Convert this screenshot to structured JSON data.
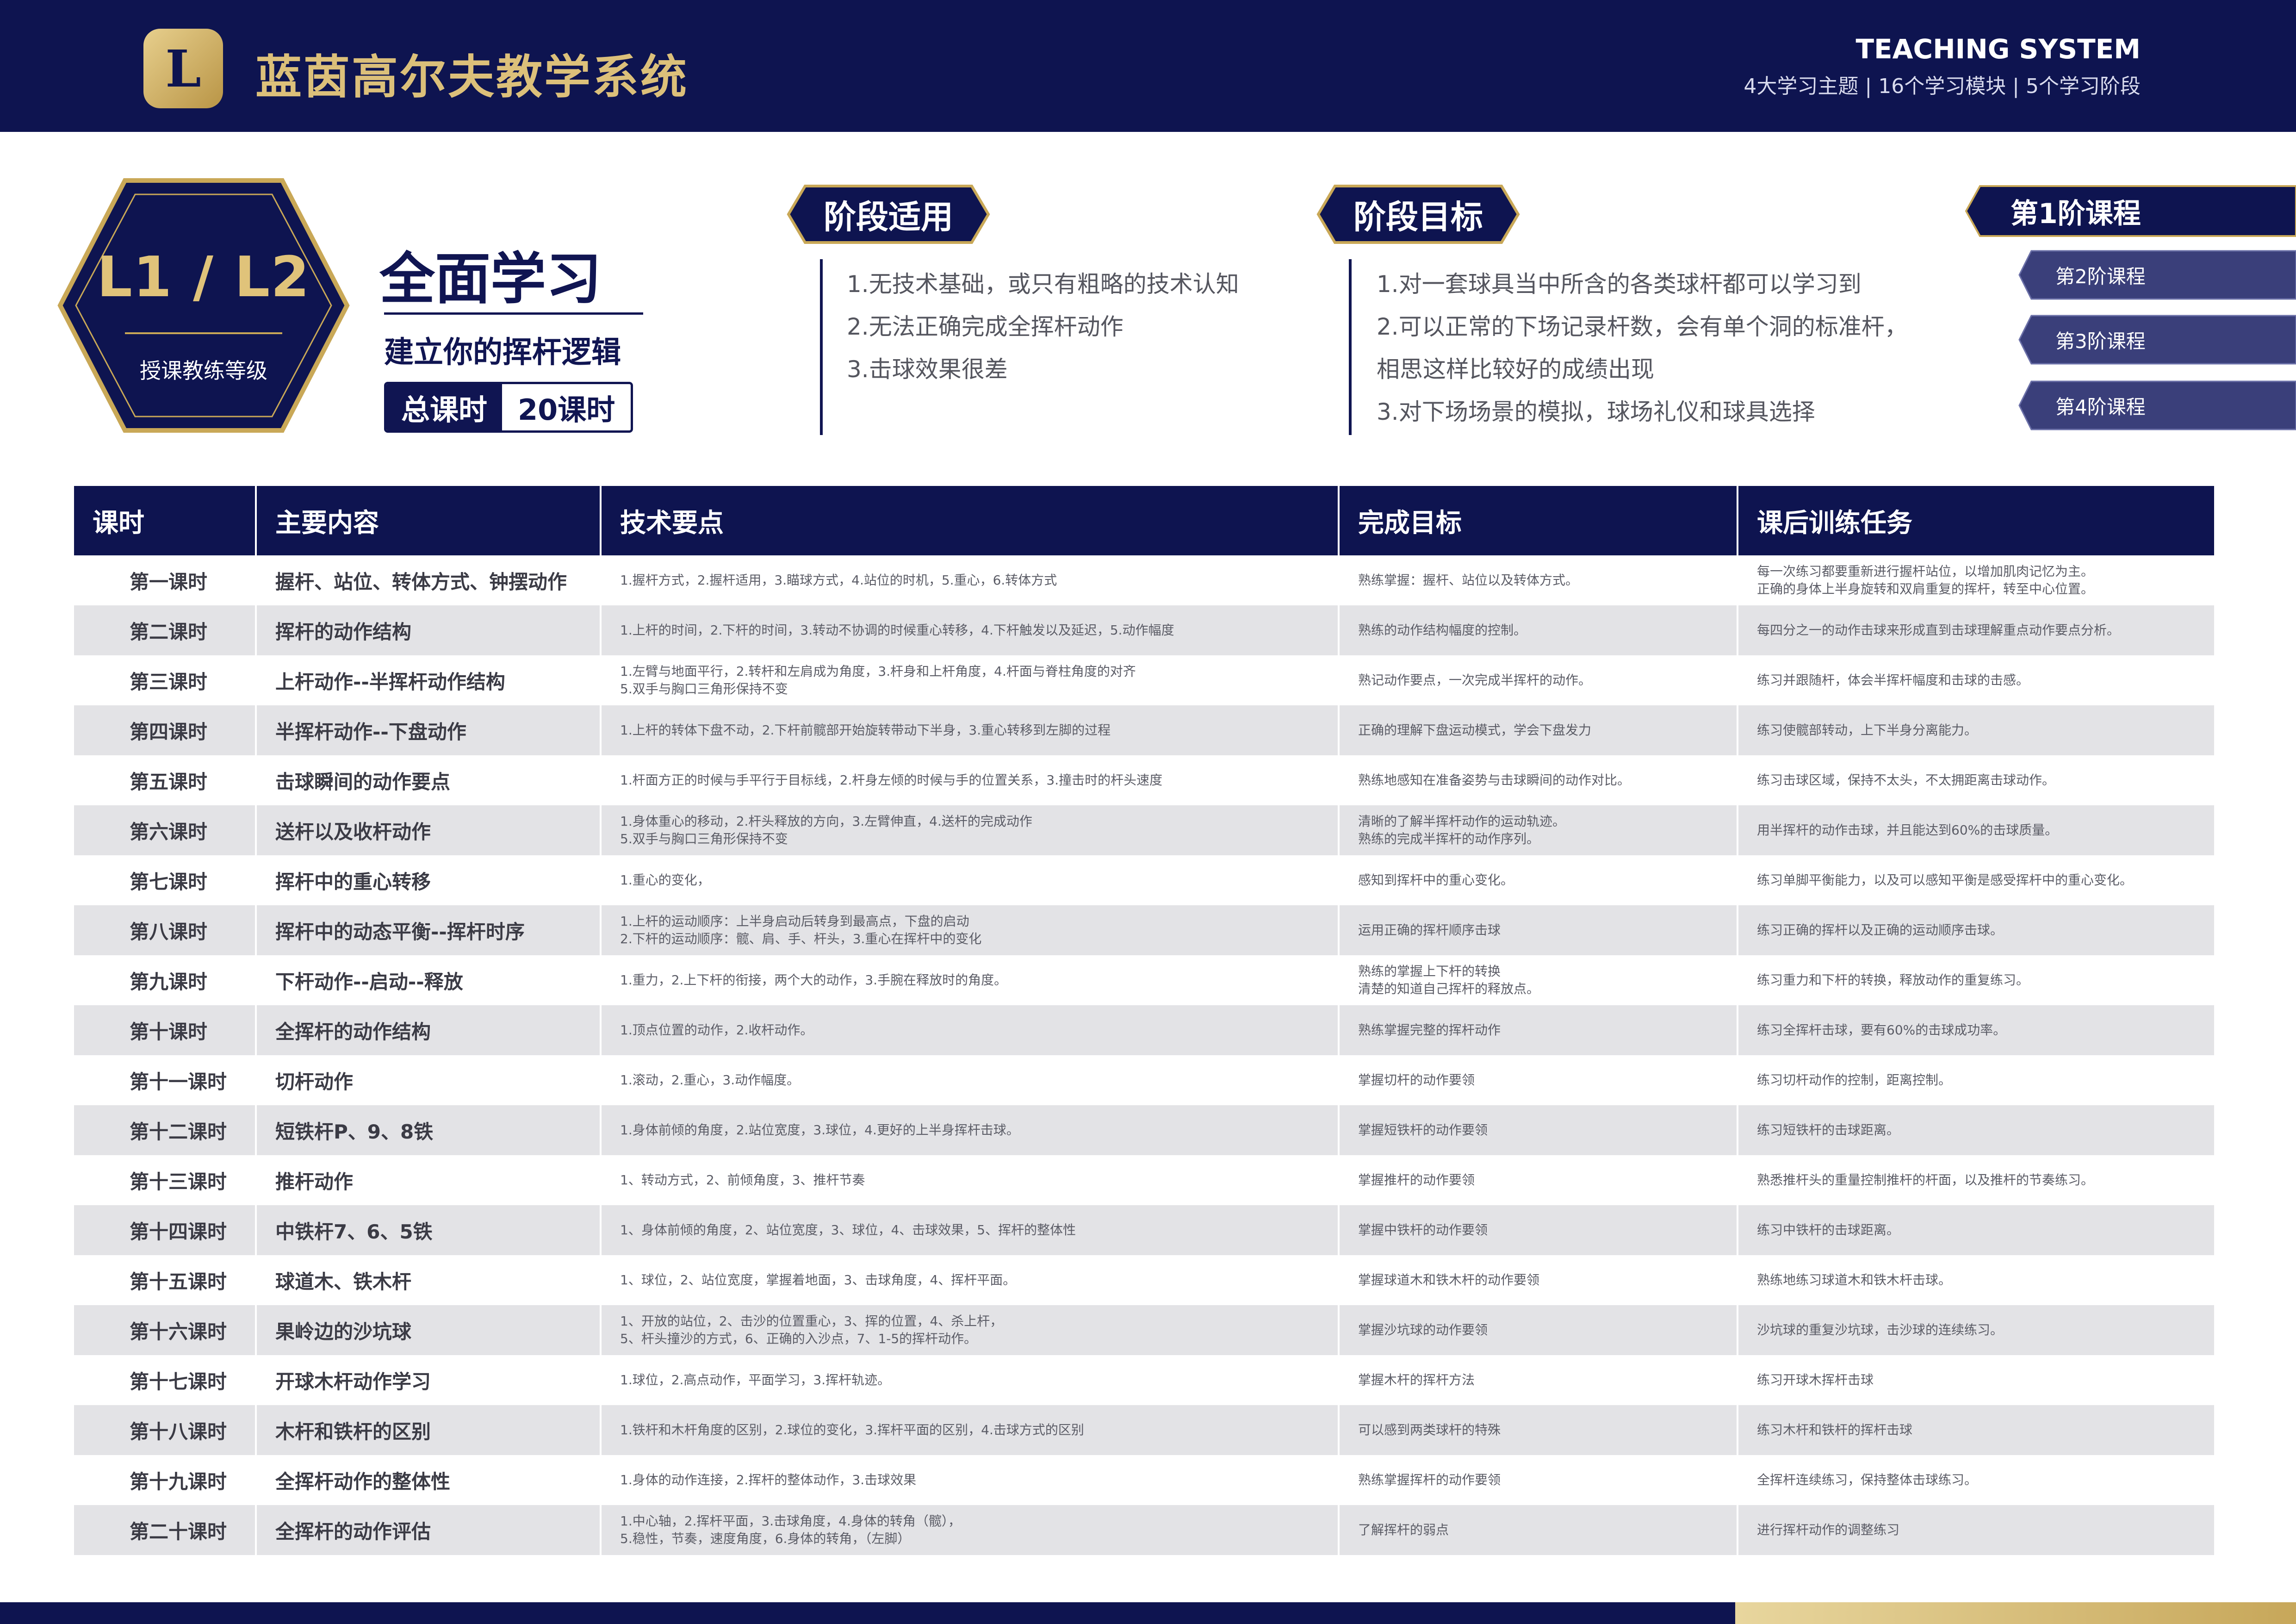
{
  "header": {
    "brand": "蓝茵高尔夫教学系统",
    "system_title": "TEACHING SYSTEM",
    "system_subtitle": "4大学习主题 | 16个学习模块 | 5个学习阶段",
    "logo_icon": "golf-logo-icon",
    "colors": {
      "navy": "#0e1450",
      "gold": "#dcc07a"
    }
  },
  "level": {
    "badge": "L1 / L2",
    "label": "授课教练等级",
    "title": "全面学习",
    "subtitle": "建立你的挥杆逻辑",
    "hours_label": "总课时",
    "hours_value": "20课时"
  },
  "applicable": {
    "heading": "阶段适用",
    "items": [
      "1.无技术基础，或只有粗略的技术认知",
      "2.无法正确完成全挥杆动作",
      "3.击球效果很差"
    ]
  },
  "goals": {
    "heading": "阶段目标",
    "items": [
      "1.对一套球具当中所含的各类球杆都可以学习到",
      "2.可以正常的下场记录杆数，会有单个洞的标准杆，",
      "   相思这样比较好的成绩出现",
      "3.对下场场景的模拟，球场礼仪和球具选择"
    ]
  },
  "stages": {
    "current": "第1阶课程",
    "others": [
      "第2阶课程",
      "第3阶课程",
      "第4阶课程"
    ]
  },
  "table": {
    "headers": [
      "课时",
      "主要内容",
      "技术要点",
      "完成目标",
      "课后训练任务"
    ],
    "rows": [
      [
        "第一课时",
        "握杆、站位、转体方式、钟摆动作",
        "1.握杆方式，2.握杆适用，3.瞄球方式，4.站位的时机，5.重心，6.转体方式",
        "熟练掌握：握杆、站位以及转体方式。",
        "每一次练习都要重新进行握杆站位，以增加肌肉记忆为主。\n正确的身体上半身旋转和双肩重复的挥杆，转至中心位置。"
      ],
      [
        "第二课时",
        "挥杆的动作结构",
        "1.上杆的时间，2.下杆的时间，3.转动不协调的时候重心转移，4.下杆触发以及延迟，5.动作幅度",
        "熟练的动作结构幅度的控制。",
        "每四分之一的动作击球来形成直到击球理解重点动作要点分析。"
      ],
      [
        "第三课时",
        "上杆动作--半挥杆动作结构",
        "1.左臂与地面平行，2.转杆和左肩成为角度，3.杆身和上杆角度，4.杆面与脊柱角度的对齐\n5.双手与胸口三角形保持不变",
        "熟记动作要点，一次完成半挥杆的动作。",
        "练习并跟随杆，体会半挥杆幅度和击球的击感。"
      ],
      [
        "第四课时",
        "半挥杆动作--下盘动作",
        "1.上杆的转体下盘不动，2.下杆前髋部开始旋转带动下半身，3.重心转移到左脚的过程",
        "正确的理解下盘运动模式，学会下盘发力",
        "练习使髋部转动，上下半身分离能力。"
      ],
      [
        "第五课时",
        "击球瞬间的动作要点",
        "1.杆面方正的时候与手平行于目标线，2.杆身左倾的时候与手的位置关系，3.撞击时的杆头速度",
        "熟练地感知在准备姿势与击球瞬间的动作对比。",
        "练习击球区域，保持不太头，不太拥距离击球动作。"
      ],
      [
        "第六课时",
        "送杆以及收杆动作",
        "1.身体重心的移动，2.杆头释放的方向，3.左臂伸直，4.送杆的完成动作\n5.双手与胸口三角形保持不变",
        "清晰的了解半挥杆动作的运动轨迹。\n熟练的完成半挥杆的动作序列。",
        "用半挥杆的动作击球，并且能达到60%的击球质量。"
      ],
      [
        "第七课时",
        "挥杆中的重心转移",
        "1.重心的变化，",
        "感知到挥杆中的重心变化。",
        "练习单脚平衡能力，以及可以感知平衡是感受挥杆中的重心变化。"
      ],
      [
        "第八课时",
        "挥杆中的动态平衡--挥杆时序",
        "1.上杆的运动顺序：上半身启动后转身到最高点，下盘的启动\n2.下杆的运动顺序：髋、肩、手、杆头，3.重心在挥杆中的变化",
        "运用正确的挥杆顺序击球",
        "练习正确的挥杆以及正确的运动顺序击球。"
      ],
      [
        "第九课时",
        "下杆动作--启动--释放",
        "1.重力，2.上下杆的衔接，两个大的动作，3.手腕在释放时的角度。",
        "熟练的掌握上下杆的转换\n清楚的知道自己挥杆的释放点。",
        "练习重力和下杆的转换，释放动作的重复练习。"
      ],
      [
        "第十课时",
        "全挥杆的动作结构",
        "1.顶点位置的动作，2.收杆动作。",
        "熟练掌握完整的挥杆动作",
        "练习全挥杆击球，要有60%的击球成功率。"
      ],
      [
        "第十一课时",
        "切杆动作",
        "1.滚动，2.重心，3.动作幅度。",
        "掌握切杆的动作要领",
        "练习切杆动作的控制，距离控制。"
      ],
      [
        "第十二课时",
        "短铁杆P、9、8铁",
        "1.身体前倾的角度，2.站位宽度，3.球位，4.更好的上半身挥杆击球。",
        "掌握短铁杆的动作要领",
        "练习短铁杆的击球距离。"
      ],
      [
        "第十三课时",
        "推杆动作",
        "1、转动方式，2、前倾角度，3、推杆节奏",
        "掌握推杆的动作要领",
        "熟悉推杆头的重量控制推杆的杆面，以及推杆的节奏练习。"
      ],
      [
        "第十四课时",
        "中铁杆7、6、5铁",
        "1、身体前倾的角度，2、站位宽度，3、球位，4、击球效果，5、挥杆的整体性",
        "掌握中铁杆的动作要领",
        "练习中铁杆的击球距离。"
      ],
      [
        "第十五课时",
        "球道木、铁木杆",
        "1、球位，2、站位宽度，掌握着地面，3、击球角度，4、挥杆平面。",
        "掌握球道木和铁木杆的动作要领",
        "熟练地练习球道木和铁木杆击球。"
      ],
      [
        "第十六课时",
        "果岭边的沙坑球",
        "1、开放的站位，2、击沙的位置重心，3、挥的位置，4、杀上杆，\n5、杆头撞沙的方式，6、正确的入沙点，7、1-5的挥杆动作。",
        "掌握沙坑球的动作要领",
        "沙坑球的重复沙坑球，击沙球的连续练习。"
      ],
      [
        "第十七课时",
        "开球木杆动作学习",
        "1.球位，2.高点动作，平面学习，3.挥杆轨迹。",
        "掌握木杆的挥杆方法",
        "练习开球木挥杆击球"
      ],
      [
        "第十八课时",
        "木杆和铁杆的区别",
        "1.铁杆和木杆角度的区别，2.球位的变化，3.挥杆平面的区别，4.击球方式的区别",
        "可以感到两类球杆的特殊",
        "练习木杆和铁杆的挥杆击球"
      ],
      [
        "第十九课时",
        "全挥杆动作的整体性",
        "1.身体的动作连接，2.挥杆的整体动作，3.击球效果",
        "熟练掌握挥杆的动作要领",
        "全挥杆连续练习，保持整体击球练习。"
      ],
      [
        "第二十课时",
        "全挥杆的动作评估",
        "1.中心轴，2.挥杆平面，3.击球角度，4.身体的转角（髋），\n5.稳性，节奏，速度角度，6.身体的转角，（左脚）",
        "了解挥杆的弱点",
        "进行挥杆动作的调整练习"
      ]
    ]
  }
}
